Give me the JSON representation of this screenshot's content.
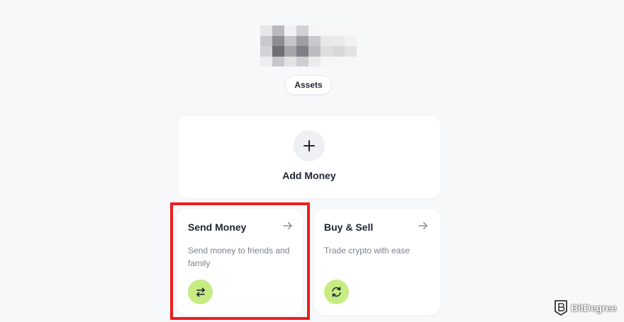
{
  "header": {
    "assets_label": "Assets"
  },
  "add_money": {
    "label": "Add Money",
    "icon": "plus-icon"
  },
  "actions": [
    {
      "title": "Send Money",
      "description": "Send money to friends and family",
      "arrow_icon": "arrow-right-icon",
      "icon": "swap-arrows-icon"
    },
    {
      "title": "Buy & Sell",
      "description": "Trade crypto with ease",
      "arrow_icon": "arrow-right-icon",
      "icon": "refresh-icon"
    }
  ],
  "watermark": {
    "text": "BitDegree"
  },
  "colors": {
    "background": "#f7f8fa",
    "card": "#ffffff",
    "accent_green": "#c6ec83",
    "highlight_red": "#ee1d1d",
    "text_primary": "#1f2430",
    "text_secondary": "#7c828d"
  }
}
